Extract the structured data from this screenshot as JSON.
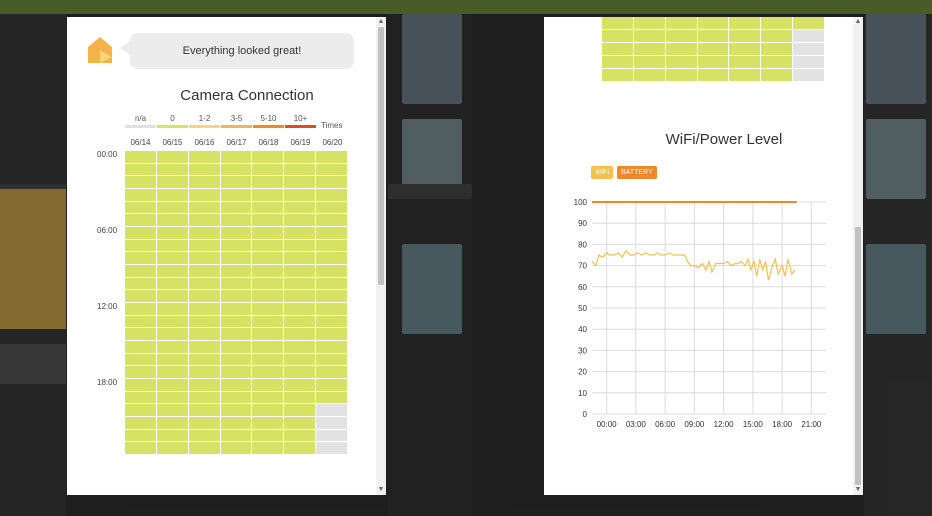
{
  "panel1": {
    "message": "Everything looked great!",
    "title": "Camera Connection",
    "legend": [
      {
        "label": "n/a",
        "color": "#e0e0e0"
      },
      {
        "label": "0",
        "color": "#d6e264"
      },
      {
        "label": "1-2",
        "color": "#f5d57e"
      },
      {
        "label": "3-5",
        "color": "#f4b25e"
      },
      {
        "label": "5-10",
        "color": "#f0882a"
      },
      {
        "label": "10+",
        "color": "#e34b1c"
      }
    ],
    "legend_unit": "Times",
    "dates": [
      "06/14",
      "06/15",
      "06/16",
      "06/17",
      "06/18",
      "06/19",
      "06/20"
    ],
    "hours": [
      "00:00",
      "06:00",
      "12:00",
      "18:00"
    ]
  },
  "panel2": {
    "title": "WiFi/Power Level",
    "legend_wifi": "WiFi",
    "legend_battery": "BATTERY"
  },
  "chart_data": {
    "type": "line",
    "title": "WiFi/Power Level",
    "x_ticks": [
      "00:00",
      "03:00",
      "06:00",
      "09:00",
      "12:00",
      "15:00",
      "18:00",
      "21:00"
    ],
    "y_ticks": [
      0,
      10,
      20,
      30,
      40,
      50,
      60,
      70,
      80,
      90,
      100
    ],
    "ylim": [
      0,
      100
    ],
    "xlim_hours": [
      -1.5,
      22.5
    ],
    "grid": true,
    "legend_position": "top-left",
    "series": [
      {
        "name": "WiFi",
        "color": "#f5c04e",
        "x": [
          -1.5,
          -1.1,
          -0.8,
          -0.4,
          0.0,
          0.4,
          0.8,
          1.2,
          1.6,
          2.0,
          2.4,
          2.8,
          3.2,
          3.6,
          4.0,
          4.4,
          4.8,
          5.2,
          5.6,
          6.0,
          6.4,
          6.8,
          7.2,
          7.6,
          8.0,
          8.3,
          8.6,
          9.0,
          9.4,
          9.8,
          10.2,
          10.5,
          10.8,
          11.2,
          11.6,
          12.0,
          12.4,
          12.8,
          13.2,
          13.5,
          13.8,
          14.2,
          14.5,
          14.8,
          15.1,
          15.4,
          15.7,
          16.0,
          16.3,
          16.6,
          17.0,
          17.3,
          17.6,
          18.0,
          18.3,
          18.6,
          19.0,
          19.3
        ],
        "y": [
          72,
          70,
          75,
          74,
          76,
          75,
          75,
          76,
          74,
          77,
          75,
          75,
          76,
          75,
          76,
          75,
          75,
          76,
          75,
          75,
          76,
          75,
          75,
          75,
          75,
          72,
          70,
          70,
          69,
          71,
          68,
          72,
          67,
          71,
          71,
          71,
          72,
          70,
          71,
          71,
          72,
          70,
          73,
          68,
          72,
          65,
          73,
          68,
          72,
          63,
          70,
          73,
          66,
          70,
          65,
          73,
          66,
          68
        ]
      },
      {
        "name": "BATTERY",
        "color": "#f0882a",
        "x": [
          -1.5,
          19.5
        ],
        "y": [
          100,
          100
        ]
      }
    ]
  }
}
